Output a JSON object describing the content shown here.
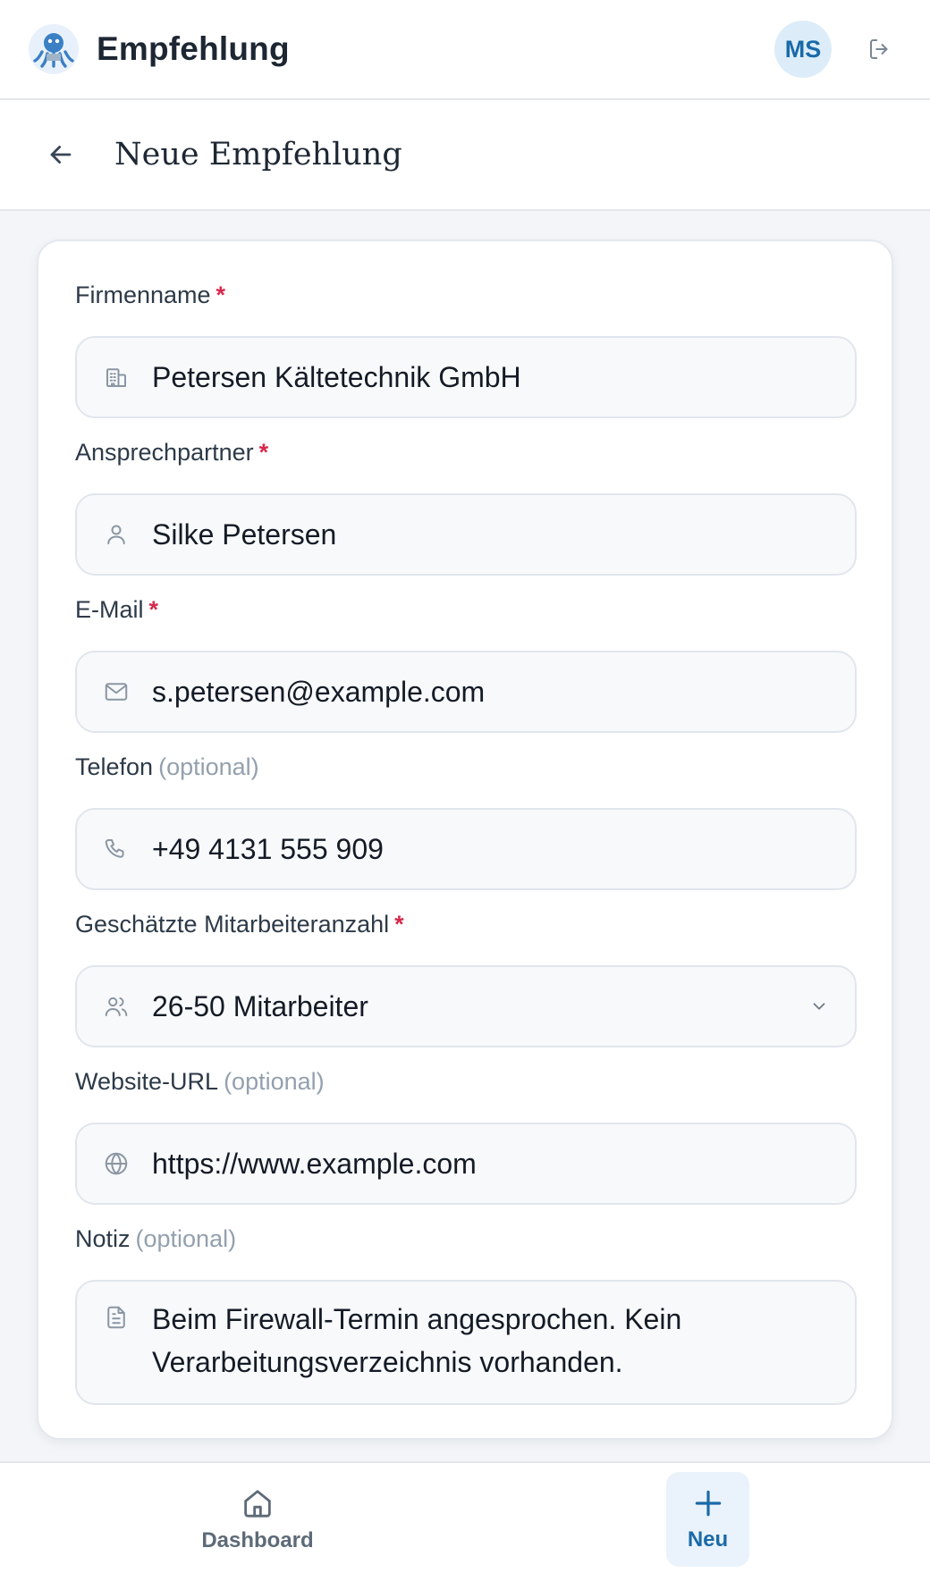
{
  "header": {
    "app_name": "Empfehlung",
    "avatar_initials": "MS"
  },
  "page": {
    "title": "Neue Empfehlung"
  },
  "form": {
    "company": {
      "label": "Firmenname",
      "required_mark": "*",
      "value": "Petersen Kältetechnik GmbH",
      "icon": "building-icon"
    },
    "contact": {
      "label": "Ansprechpartner",
      "required_mark": "*",
      "value": "Silke Petersen",
      "icon": "user-icon"
    },
    "email": {
      "label": "E-Mail",
      "required_mark": "*",
      "value": "s.petersen@example.com",
      "icon": "mail-icon"
    },
    "phone": {
      "label": "Telefon",
      "optional_mark": "(optional)",
      "value": "+49 4131 555 909",
      "icon": "phone-icon"
    },
    "employees": {
      "label": "Geschätzte Mitarbeiteranzahl",
      "required_mark": "*",
      "value": "26-50 Mitarbeiter",
      "icon": "users-icon"
    },
    "website": {
      "label": "Website-URL",
      "optional_mark": "(optional)",
      "value": "https://www.example.com",
      "icon": "globe-icon"
    },
    "note": {
      "label": "Notiz",
      "optional_mark": "(optional)",
      "value": "Beim Firewall-Termin angesprochen. Kein Verarbeitungsverzeichnis vorhanden.",
      "icon": "document-icon"
    }
  },
  "bottom_nav": {
    "dashboard_label": "Dashboard",
    "new_label": "Neu"
  },
  "colors": {
    "accent": "#1a6aa8",
    "required": "#d6294c",
    "muted": "#93a0ae"
  }
}
